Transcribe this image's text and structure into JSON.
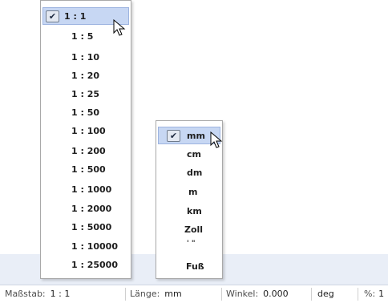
{
  "scale_menu": {
    "items": [
      "1 : 1",
      "1 : 5",
      "1 : 10",
      "1 : 20",
      "1 : 25",
      "1 : 50",
      "1 : 100",
      "1 : 200",
      "1 : 500",
      "1 : 1000",
      "1 : 2000",
      "1 : 5000",
      "1 : 10000",
      "1 : 25000"
    ],
    "selected": "1 : 1"
  },
  "unit_menu": {
    "items": [
      "mm",
      "cm",
      "dm",
      "m",
      "km",
      "Zoll",
      "' \"",
      "Fuß"
    ],
    "selected": "mm"
  },
  "status_bar": {
    "scale_label": "Maßstab:",
    "scale_value": "1 : 1",
    "length_label": "Länge:",
    "length_value": "mm",
    "angle_label": "Winkel:",
    "angle_value": "0.000",
    "angle_unit": "deg",
    "percent_label": "%:",
    "percent_value": "1"
  },
  "icons": {
    "check": "checkmark-icon",
    "cursor": "mouse-pointer-icon"
  },
  "colors": {
    "selection": "#c7d7f3",
    "band": "#e9eef7"
  }
}
